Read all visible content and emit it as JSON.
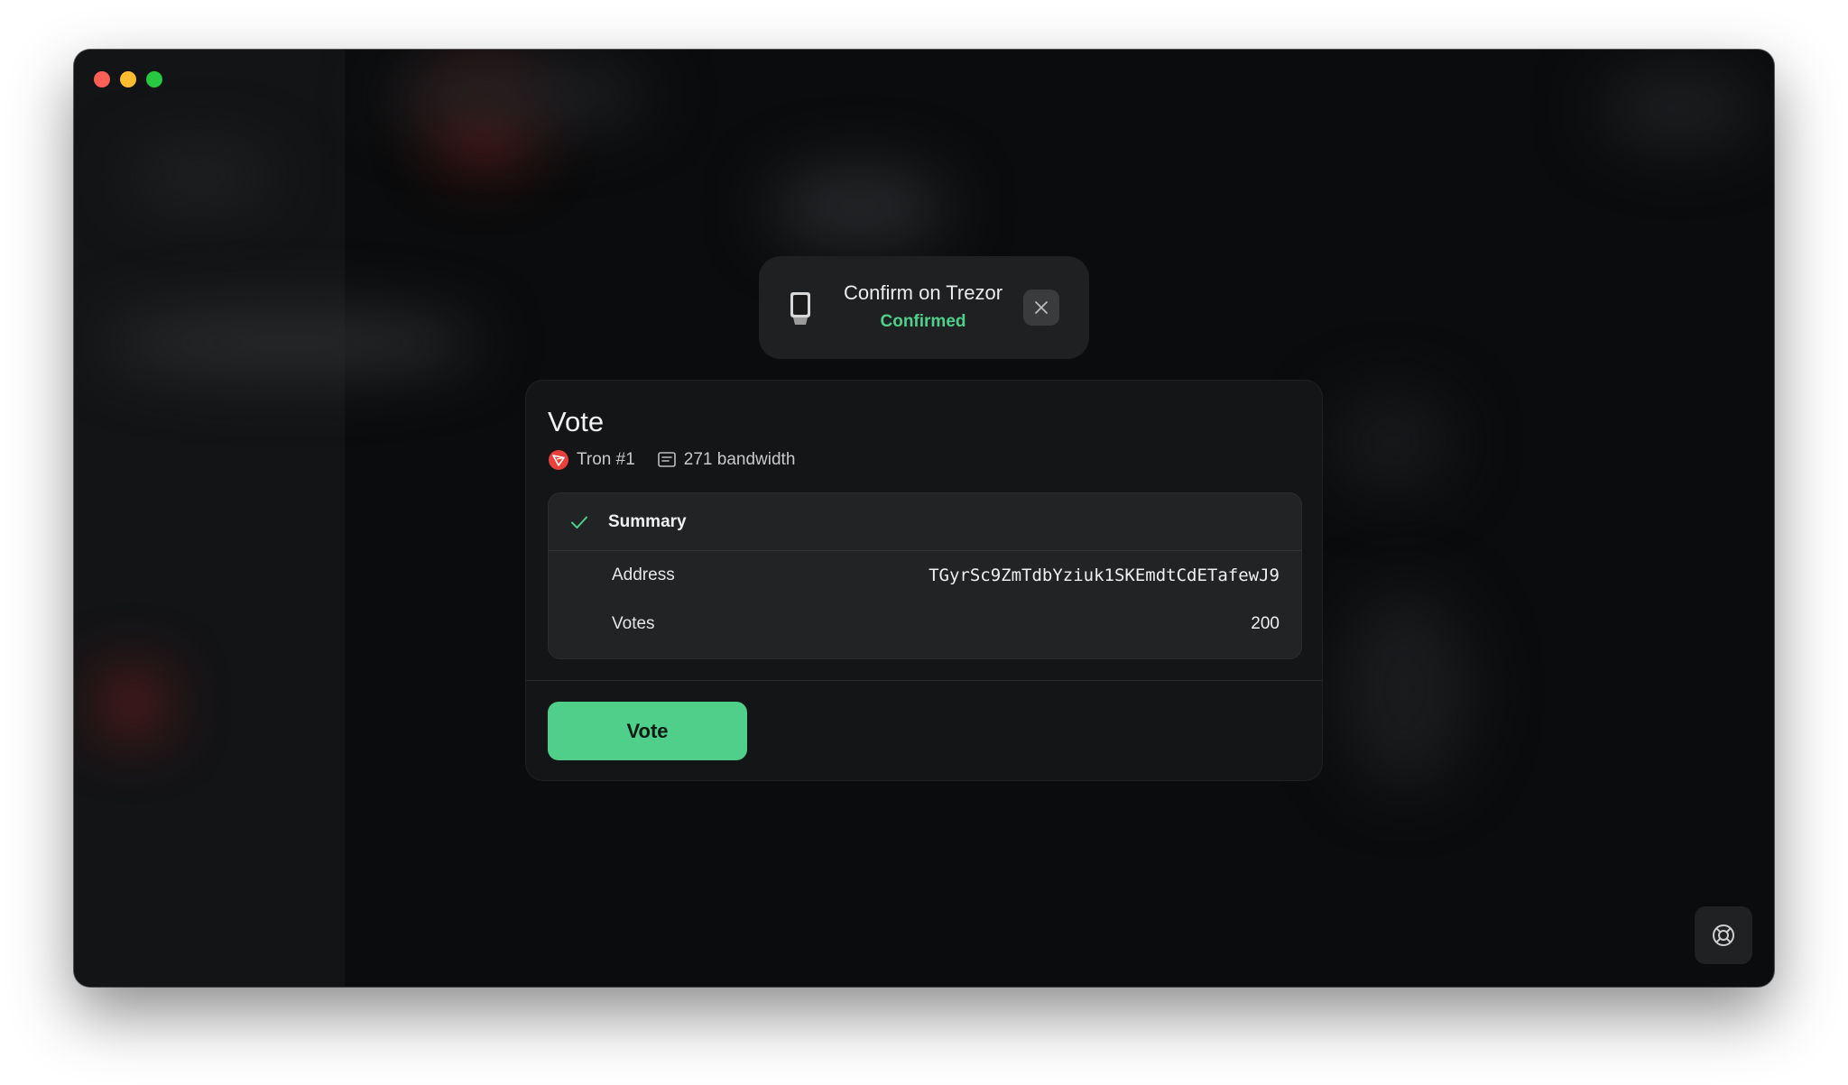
{
  "toast": {
    "title": "Confirm on Trezor",
    "status": "Confirmed",
    "device_icon": "trezor-device-icon",
    "close_icon": "close-icon"
  },
  "modal": {
    "title": "Vote",
    "account": {
      "icon": "tron-icon",
      "label": "Tron #1"
    },
    "bandwidth": {
      "icon": "receipt-icon",
      "label": "271 bandwidth"
    },
    "summary": {
      "icon": "check-icon",
      "label": "Summary",
      "rows": [
        {
          "label": "Address",
          "value": "TGyrSc9ZmTdbYziuk1SKEmdtCdETafewJ9"
        },
        {
          "label": "Votes",
          "value": "200"
        }
      ]
    },
    "action_label": "Vote"
  },
  "help": {
    "icon": "lifebuoy-icon"
  },
  "colors": {
    "accent": "#4fcf8a",
    "window_bg": "#0b0c0d",
    "panel_bg": "#141516",
    "tron_red": "#e8403b"
  }
}
